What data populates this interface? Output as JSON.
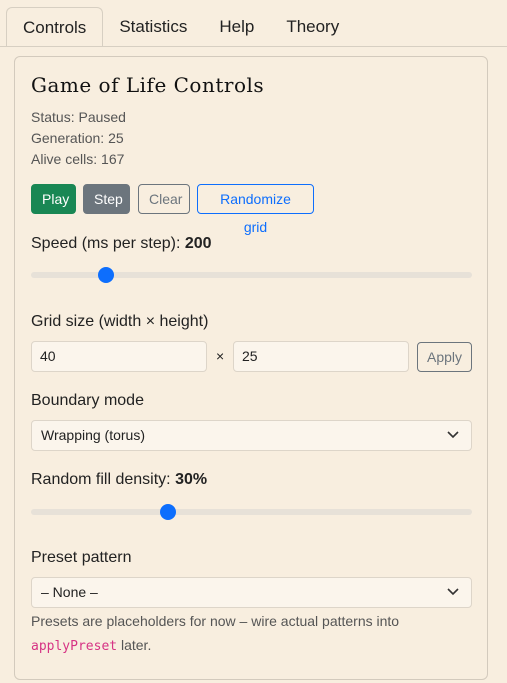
{
  "tabs": [
    {
      "label": "Controls",
      "active": true
    },
    {
      "label": "Statistics",
      "active": false
    },
    {
      "label": "Help",
      "active": false
    },
    {
      "label": "Theory",
      "active": false
    }
  ],
  "panel": {
    "title": "Game of Life Controls",
    "status_label": "Status:",
    "status_value": "Paused",
    "generation_label": "Generation:",
    "generation_value": "25",
    "alive_label": "Alive cells:",
    "alive_value": "167"
  },
  "buttons": {
    "play": "Play",
    "step": "Step",
    "clear": "Clear",
    "randomize": "Randomize grid"
  },
  "speed": {
    "label": "Speed (ms per step):",
    "value": "200",
    "fraction": 0.17
  },
  "grid": {
    "label": "Grid size (width × height)",
    "width": "40",
    "times": "×",
    "height": "25",
    "apply": "Apply"
  },
  "boundary": {
    "label": "Boundary mode",
    "selected": "Wrapping (torus)"
  },
  "density": {
    "label": "Random fill density:",
    "value": "30%",
    "fraction": 0.31
  },
  "preset": {
    "label": "Preset pattern",
    "selected": "– None –",
    "help_before": "Presets are placeholders for now – wire actual patterns into",
    "help_code": "applyPreset",
    "help_after": "later."
  },
  "icons": {
    "chevron": "chevron-down-icon"
  },
  "colors": {
    "background": "#f8eedf",
    "play": "#198754",
    "step": "#6c757d",
    "primary": "#0d6efd",
    "code": "#d63384"
  }
}
